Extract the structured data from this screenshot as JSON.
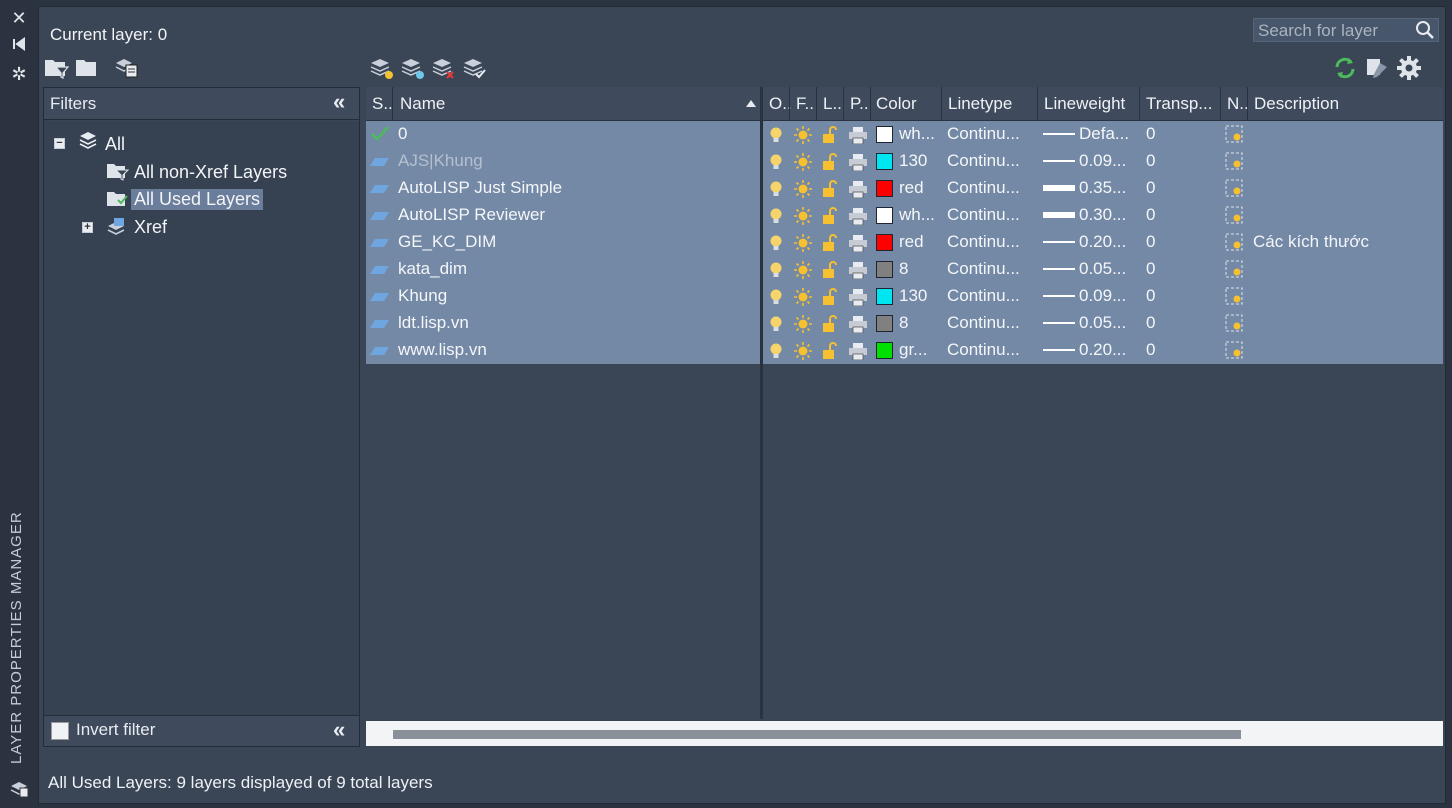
{
  "panel": {
    "title": "LAYER PROPERTIES MANAGER",
    "current_layer": "Current layer: 0",
    "search_placeholder": "Search for layer"
  },
  "filters": {
    "header": "Filters",
    "tree": {
      "root": "All",
      "children": [
        "All non-Xref Layers",
        "All Used Layers",
        "Xref"
      ],
      "selected": "All Used Layers"
    },
    "invert_label": "Invert filter"
  },
  "columns": [
    "S..",
    "Name",
    "O..",
    "F..",
    "L..",
    "P..",
    "Color",
    "Linetype",
    "Lineweight",
    "Transp...",
    "N..",
    "Description"
  ],
  "layers": [
    {
      "name": "0",
      "current": true,
      "color_name": "wh...",
      "color_hex": "#ffffff",
      "linetype": "Continu...",
      "lineweight": "Defa...",
      "transparency": "0",
      "description": ""
    },
    {
      "name": "AJS|Khung",
      "xref": true,
      "color_name": "130",
      "color_hex": "#00e6f0",
      "linetype": "Continu...",
      "lineweight": "0.09...",
      "transparency": "0",
      "description": ""
    },
    {
      "name": "AutoLISP Just Simple",
      "color_name": "red",
      "color_hex": "#ff0000",
      "linetype": "Continu...",
      "lineweight": "0.35...",
      "transparency": "0",
      "description": ""
    },
    {
      "name": "AutoLISP Reviewer",
      "color_name": "wh...",
      "color_hex": "#ffffff",
      "linetype": "Continu...",
      "lineweight": "0.30...",
      "transparency": "0",
      "description": ""
    },
    {
      "name": "GE_KC_DIM",
      "color_name": "red",
      "color_hex": "#ff0000",
      "linetype": "Continu...",
      "lineweight": "0.20...",
      "transparency": "0",
      "description": "Các kích thước"
    },
    {
      "name": "kata_dim",
      "color_name": "8",
      "color_hex": "#808080",
      "linetype": "Continu...",
      "lineweight": "0.05...",
      "transparency": "0",
      "description": ""
    },
    {
      "name": "Khung",
      "color_name": "130",
      "color_hex": "#00e6f0",
      "linetype": "Continu...",
      "lineweight": "0.09...",
      "transparency": "0",
      "description": ""
    },
    {
      "name": "ldt.lisp.vn",
      "color_name": "8",
      "color_hex": "#808080",
      "linetype": "Continu...",
      "lineweight": "0.05...",
      "transparency": "0",
      "description": ""
    },
    {
      "name": "www.lisp.vn",
      "color_name": "gr...",
      "color_hex": "#00e000",
      "linetype": "Continu...",
      "lineweight": "0.20...",
      "transparency": "0",
      "description": ""
    }
  ],
  "status_text": "All Used Layers: 9 layers displayed of 9 total layers",
  "icons": [
    "close-icon",
    "auto-hide-icon",
    "properties-icon",
    "new-property-filter-icon",
    "new-group-filter-icon",
    "layer-states-manager-icon",
    "new-layer-icon",
    "new-layer-vp-frozen-icon",
    "delete-layer-icon",
    "set-current-icon",
    "refresh-icon",
    "modify-display-icon",
    "settings-icon",
    "search-icon"
  ],
  "colors": {
    "selected_row": "#7489a6",
    "panel_bg": "#3a4556",
    "accent_green": "#4cbb5a"
  }
}
